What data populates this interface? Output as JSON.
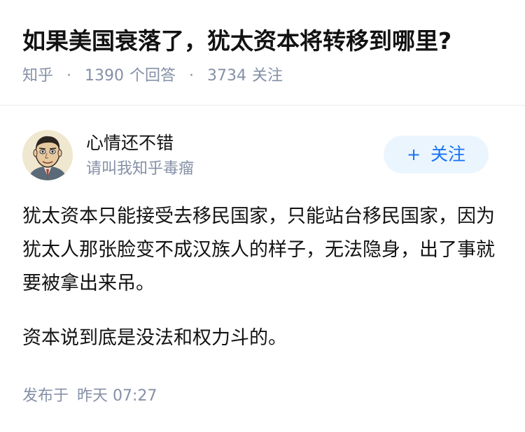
{
  "question": {
    "title": "如果美国衰落了，犹太资本将转移到哪里?",
    "source": "知乎",
    "answer_count": "1390",
    "answer_label": "个回答",
    "follower_count": "3734",
    "follower_label": "关注"
  },
  "author": {
    "name": "心情还不错",
    "headline": "请叫我知乎毒瘤",
    "avatar_icon": "cartoon-face-avatar",
    "follow_label": "关注",
    "follow_icon": "plus-icon",
    "accent_color": "#1772f6"
  },
  "answer": {
    "paragraphs": [
      "犹太资本只能接受去移民国家，只能站台移民国家，因为犹太人那张脸变不成汉族人的样子，无法隐身，出了事就要被拿出来吊。",
      "资本说到底是没法和权力斗的。"
    ],
    "published_label": "发布于",
    "published_time": "昨天 07:27"
  }
}
